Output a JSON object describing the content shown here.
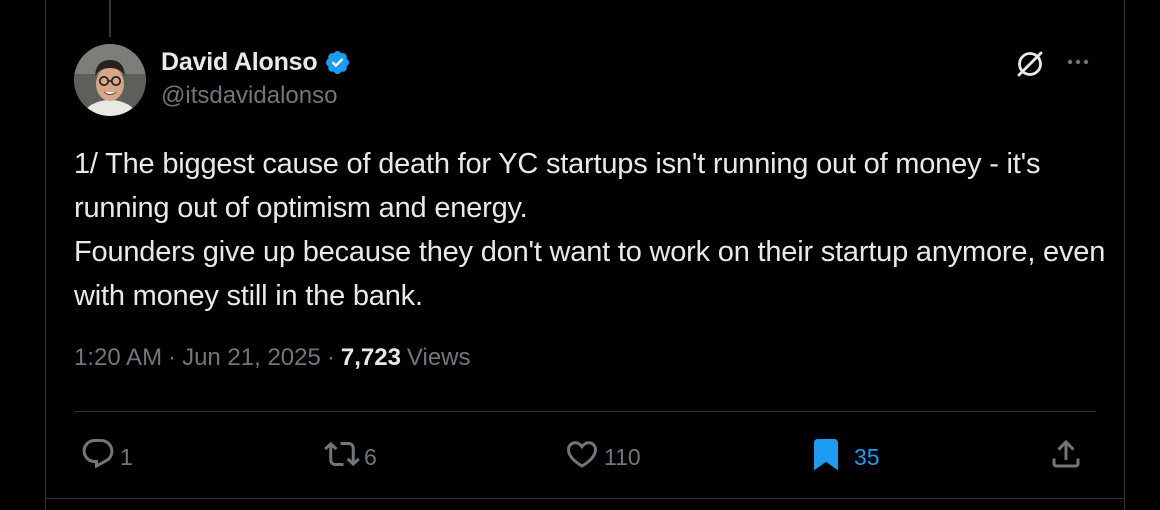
{
  "author": {
    "display_name": "David Alonso",
    "handle": "@itsdavidalonso",
    "verified": true
  },
  "tweet": {
    "lines": [
      "1/ The biggest cause of death for YC startups isn't running out of money - it's running out of optimism and energy.",
      "Founders give up because they don't want to work on their startup anymore, even with money still in the bank."
    ],
    "time": "1:20 AM",
    "date": "Jun 21, 2025",
    "views_count": "7,723",
    "views_label": "Views"
  },
  "actions": {
    "replies": "1",
    "reposts": "6",
    "likes": "110",
    "bookmarks": "35"
  },
  "colors": {
    "background": "#000000",
    "text": "#e7e9ea",
    "muted": "#71767b",
    "accent": "#1d9bf0",
    "border": "#2f3336"
  },
  "icons": {
    "verified": "verified-badge-icon",
    "grok": "grok-icon",
    "more": "more-icon",
    "reply": "reply-icon",
    "repost": "repost-icon",
    "like": "like-icon",
    "bookmark": "bookmark-icon",
    "share": "share-icon"
  }
}
